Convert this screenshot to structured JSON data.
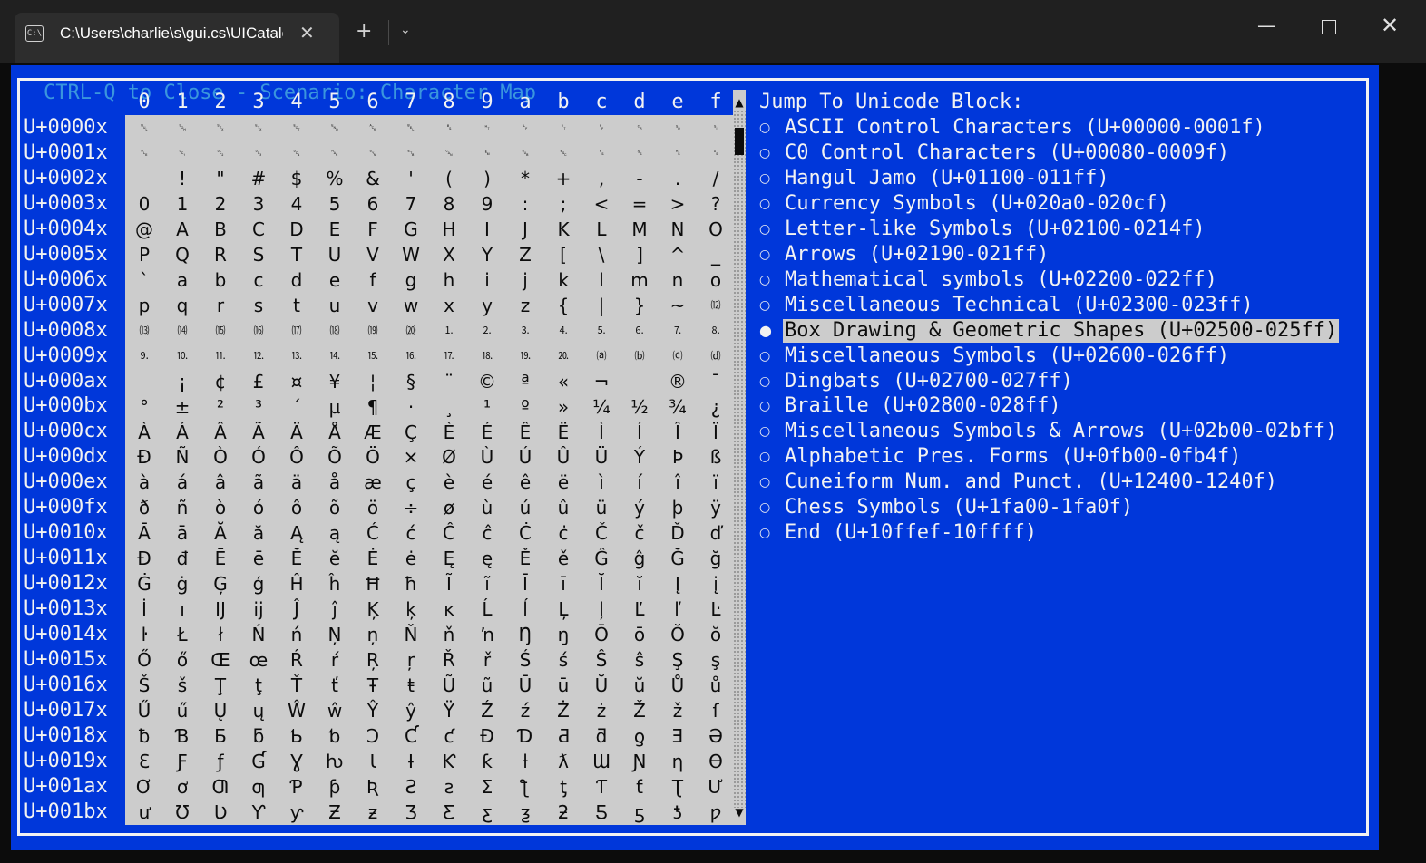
{
  "window": {
    "tab_title": "C:\\Users\\charlie\\s\\gui.cs\\UICatalog",
    "tab_icon": "console-icon"
  },
  "frame_title": "CTRL-Q to Close - Scenario: Character Map",
  "charmap": {
    "columns": [
      "0",
      "1",
      "2",
      "3",
      "4",
      "5",
      "6",
      "7",
      "8",
      "9",
      "a",
      "b",
      "c",
      "d",
      "e",
      "f"
    ],
    "rows": [
      "U+0000x",
      "U+0001x",
      "U+0002x",
      "U+0003x",
      "U+0004x",
      "U+0005x",
      "U+0006x",
      "U+0007x",
      "U+0008x",
      "U+0009x",
      "U+000ax",
      "U+000bx",
      "U+000cx",
      "U+000dx",
      "U+000ex",
      "U+000fx",
      "U+0010x",
      "U+0011x",
      "U+0012x",
      "U+0013x",
      "U+0014x",
      "U+0015x",
      "U+0016x",
      "U+0017x",
      "U+0018x",
      "U+0019x",
      "U+001ax",
      "U+001bx"
    ],
    "scroll_up": "▲",
    "scroll_down": "▼",
    "glyph_rows": [
      [
        "␀",
        "␁",
        "␂",
        "␃",
        "␄",
        "␅",
        "␆",
        "␇",
        "␈",
        "␉",
        "␊",
        "␋",
        "␌",
        "␍",
        "␎",
        "␏"
      ],
      [
        "␐",
        "␑",
        "␒",
        "␓",
        "␔",
        "␕",
        "␖",
        "␗",
        "␘",
        "␙",
        "␚",
        "␛",
        "␜",
        "␝",
        "␞",
        "␟"
      ],
      [
        " ",
        "!",
        "\"",
        "#",
        "$",
        "%",
        "&",
        "'",
        "(",
        ")",
        "*",
        "+",
        ",",
        "-",
        ".",
        "/"
      ],
      [
        "0",
        "1",
        "2",
        "3",
        "4",
        "5",
        "6",
        "7",
        "8",
        "9",
        ":",
        ";",
        "<",
        "=",
        ">",
        "?"
      ],
      [
        "@",
        "A",
        "B",
        "C",
        "D",
        "E",
        "F",
        "G",
        "H",
        "I",
        "J",
        "K",
        "L",
        "M",
        "N",
        "O"
      ],
      [
        "P",
        "Q",
        "R",
        "S",
        "T",
        "U",
        "V",
        "W",
        "X",
        "Y",
        "Z",
        "[",
        "\\",
        "]",
        "^",
        "_"
      ],
      [
        "`",
        "a",
        "b",
        "c",
        "d",
        "e",
        "f",
        "g",
        "h",
        "i",
        "j",
        "k",
        "l",
        "m",
        "n",
        "o"
      ],
      [
        "p",
        "q",
        "r",
        "s",
        "t",
        "u",
        "v",
        "w",
        "x",
        "y",
        "z",
        "{",
        "|",
        "}",
        "~",
        "⑿"
      ],
      [
        "⒀",
        "⒁",
        "⒂",
        "⒃",
        "⒄",
        "⒅",
        "⒆",
        "⒇",
        "⒈",
        "⒉",
        "⒊",
        "⒋",
        "⒌",
        "⒍",
        "⒎",
        "⒏"
      ],
      [
        "⒐",
        "⒑",
        "⒒",
        "⒓",
        "⒔",
        "⒕",
        "⒖",
        "⒗",
        "⒘",
        "⒙",
        "⒚",
        "⒛",
        "⒜",
        "⒝",
        "⒞",
        "⒟"
      ],
      [
        " ",
        "¡",
        "¢",
        "£",
        "¤",
        "¥",
        "¦",
        "§",
        "¨",
        "©",
        "ª",
        "«",
        "¬",
        " ",
        "®",
        "¯"
      ],
      [
        "°",
        "±",
        "²",
        "³",
        "´",
        "µ",
        "¶",
        "·",
        "¸",
        "¹",
        "º",
        "»",
        "¼",
        "½",
        "¾",
        "¿"
      ],
      [
        "À",
        "Á",
        "Â",
        "Ã",
        "Ä",
        "Å",
        "Æ",
        "Ç",
        "È",
        "É",
        "Ê",
        "Ë",
        "Ì",
        "Í",
        "Î",
        "Ï"
      ],
      [
        "Ð",
        "Ñ",
        "Ò",
        "Ó",
        "Ô",
        "Õ",
        "Ö",
        "×",
        "Ø",
        "Ù",
        "Ú",
        "Û",
        "Ü",
        "Ý",
        "Þ",
        "ß"
      ],
      [
        "à",
        "á",
        "â",
        "ã",
        "ä",
        "å",
        "æ",
        "ç",
        "è",
        "é",
        "ê",
        "ë",
        "ì",
        "í",
        "î",
        "ï"
      ],
      [
        "ð",
        "ñ",
        "ò",
        "ó",
        "ô",
        "õ",
        "ö",
        "÷",
        "ø",
        "ù",
        "ú",
        "û",
        "ü",
        "ý",
        "þ",
        "ÿ"
      ],
      [
        "Ā",
        "ā",
        "Ă",
        "ă",
        "Ą",
        "ą",
        "Ć",
        "ć",
        "Ĉ",
        "ĉ",
        "Ċ",
        "ċ",
        "Č",
        "č",
        "Ď",
        "ď"
      ],
      [
        "Đ",
        "đ",
        "Ē",
        "ē",
        "Ĕ",
        "ĕ",
        "Ė",
        "ė",
        "Ę",
        "ę",
        "Ě",
        "ě",
        "Ĝ",
        "ĝ",
        "Ğ",
        "ğ"
      ],
      [
        "Ġ",
        "ġ",
        "Ģ",
        "ģ",
        "Ĥ",
        "ĥ",
        "Ħ",
        "ħ",
        "Ĩ",
        "ĩ",
        "Ī",
        "ī",
        "Ĭ",
        "ĭ",
        "Į",
        "į"
      ],
      [
        "İ",
        "ı",
        "Ĳ",
        "ĳ",
        "Ĵ",
        "ĵ",
        "Ķ",
        "ķ",
        "ĸ",
        "Ĺ",
        "ĺ",
        "Ļ",
        "ļ",
        "Ľ",
        "ľ",
        "Ŀ"
      ],
      [
        "ŀ",
        "Ł",
        "ł",
        "Ń",
        "ń",
        "Ņ",
        "ņ",
        "Ň",
        "ň",
        "ŉ",
        "Ŋ",
        "ŋ",
        "Ō",
        "ō",
        "Ŏ",
        "ŏ"
      ],
      [
        "Ő",
        "ő",
        "Œ",
        "œ",
        "Ŕ",
        "ŕ",
        "Ŗ",
        "ŗ",
        "Ř",
        "ř",
        "Ś",
        "ś",
        "Ŝ",
        "ŝ",
        "Ş",
        "ş"
      ],
      [
        "Š",
        "š",
        "Ţ",
        "ţ",
        "Ť",
        "ť",
        "Ŧ",
        "ŧ",
        "Ũ",
        "ũ",
        "Ū",
        "ū",
        "Ŭ",
        "ŭ",
        "Ů",
        "ů"
      ],
      [
        "Ű",
        "ű",
        "Ų",
        "ų",
        "Ŵ",
        "ŵ",
        "Ŷ",
        "ŷ",
        "Ÿ",
        "Ź",
        "ź",
        "Ż",
        "ż",
        "Ž",
        "ž",
        "ſ"
      ],
      [
        "ƀ",
        "Ɓ",
        "Ƃ",
        "ƃ",
        "Ƅ",
        "ƅ",
        "Ɔ",
        "Ƈ",
        "ƈ",
        "Ɖ",
        "Ɗ",
        "Ƌ",
        "ƌ",
        "ƍ",
        "Ǝ",
        "Ə"
      ],
      [
        "Ɛ",
        "Ƒ",
        "ƒ",
        "Ɠ",
        "Ɣ",
        "ƕ",
        "Ɩ",
        "Ɨ",
        "Ƙ",
        "ƙ",
        "ƚ",
        "ƛ",
        "Ɯ",
        "Ɲ",
        "ƞ",
        "Ɵ"
      ],
      [
        "Ơ",
        "ơ",
        "Ƣ",
        "ƣ",
        "Ƥ",
        "ƥ",
        "Ʀ",
        "Ƨ",
        "ƨ",
        "Ʃ",
        "ƪ",
        "ƫ",
        "Ƭ",
        "ƭ",
        "Ʈ",
        "Ư"
      ],
      [
        "ư",
        "Ʊ",
        "Ʋ",
        "Ƴ",
        "ƴ",
        "Ƶ",
        "ƶ",
        "Ʒ",
        "Ƹ",
        "ƹ",
        "ƺ",
        "ƻ",
        "Ƽ",
        "ƽ",
        "ƾ",
        "ƿ"
      ]
    ]
  },
  "jump": {
    "title": "Jump To Unicode Block:",
    "radio_off": "○",
    "radio_on": "●",
    "blocks": [
      "ASCII Control Characters (U+00000-0001f)",
      "C0 Control Characters (U+00080-0009f)",
      "Hangul Jamo (U+01100-011ff)",
      "Currency Symbols (U+020a0-020cf)",
      "Letter-like Symbols (U+02100-0214f)",
      "Arrows (U+02190-021ff)",
      "Mathematical symbols (U+02200-022ff)",
      "Miscellaneous Technical (U+02300-023ff)",
      "Box Drawing & Geometric Shapes (U+02500-025ff)",
      "Miscellaneous Symbols (U+02600-026ff)",
      "Dingbats (U+02700-027ff)",
      "Braille (U+02800-028ff)",
      "Miscellaneous Symbols & Arrows (U+02b00-02bff)",
      "Alphabetic Pres. Forms (U+0fb00-0fb4f)",
      "Cuneiform Num. and Punct. (U+12400-1240f)",
      "Chess Symbols (U+1fa00-1fa0f)",
      "End (U+10ffef-10ffff)"
    ],
    "selected_index": 8
  },
  "colors": {
    "console_bg": "#0037da",
    "title_accent": "#3a96dd",
    "grid_bg": "#cccccc"
  }
}
